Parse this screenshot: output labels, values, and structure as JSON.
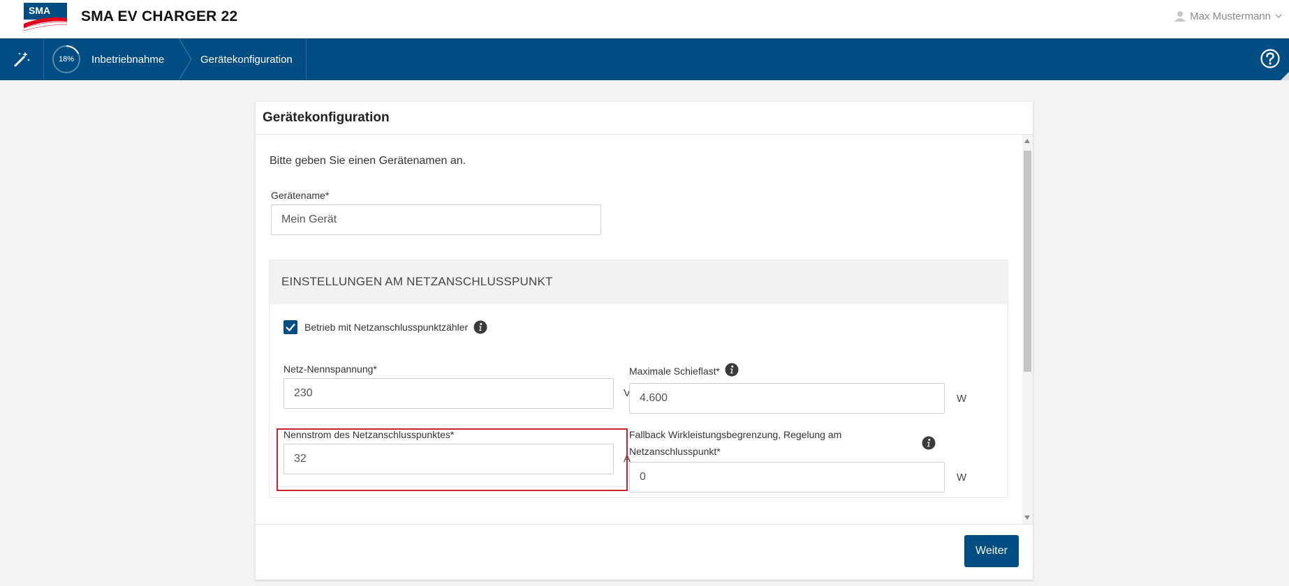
{
  "header": {
    "logo_text": "SMA",
    "app_title": "SMA EV CHARGER 22",
    "user_name": "Max Mustermann"
  },
  "nav": {
    "progress_percent": 18,
    "progress_label": "18%",
    "step1_label": "Inbetriebnahme",
    "step2_label": "Gerätekonfiguration"
  },
  "card": {
    "title": "Gerätekonfiguration",
    "intro": "Bitte geben Sie einen Gerätenamen an.",
    "device_name_label": "Gerätename*",
    "device_name_value": "Mein Gerät",
    "section_title": "EINSTELLUNGEN AM NETZANSCHLUSSPUNKT",
    "meter_checkbox_label": "Betrieb mit Netzanschlusspunktzähler",
    "meter_checkbox_checked": true,
    "voltage_label": "Netz-Nennspannung*",
    "voltage_value": "230",
    "voltage_unit": "V",
    "unbalance_label": "Maximale Schieflast*",
    "unbalance_value": "4.600",
    "unbalance_unit": "W",
    "current_label": "Nennstrom des Netzanschlusspunktes*",
    "current_value": "32",
    "current_unit": "A",
    "fallback_label_line1": "Fallback Wirkleistungsbegrenzung, Regelung am",
    "fallback_label_line2": "Netzanschlusspunkt*",
    "fallback_value": "0",
    "fallback_unit": "W",
    "next_button": "Weiter"
  },
  "colors": {
    "brand_blue": "#004d84",
    "highlight_red": "#c9242c",
    "logo_red": "#e2001a"
  }
}
